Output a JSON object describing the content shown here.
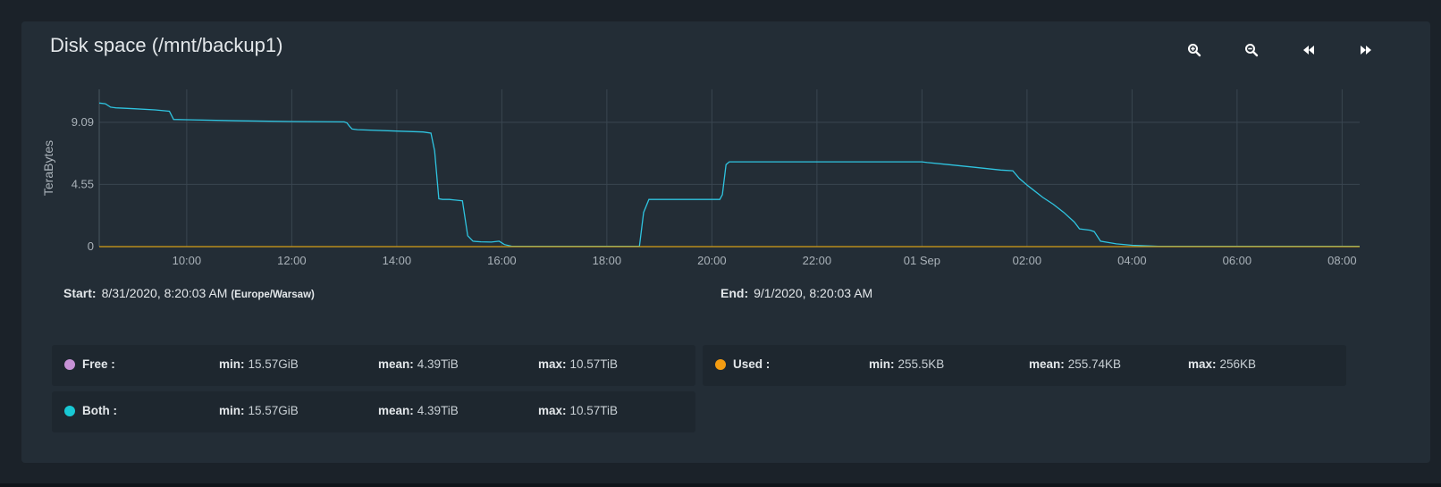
{
  "panel": {
    "title": "Disk space (/mnt/backup1)"
  },
  "toolbar": {
    "zoom_in_icon": "zoom-in-icon",
    "zoom_out_icon": "zoom-out-icon",
    "back_icon": "rewind-icon",
    "forward_icon": "fast-forward-icon"
  },
  "range": {
    "start_label": "Start:",
    "start_value": "8/31/2020, 8:20:03 AM",
    "start_tz": "(Europe/Warsaw)",
    "end_label": "End:",
    "end_value": "9/1/2020, 8:20:03 AM"
  },
  "legend": [
    {
      "name": "Free :",
      "color": "#c792d6",
      "min_label": "min:",
      "min": "15.57GiB",
      "mean_label": "mean:",
      "mean": "4.39TiB",
      "max_label": "max:",
      "max": "10.57TiB"
    },
    {
      "name": "Used :",
      "color": "#f39c12",
      "min_label": "min:",
      "min": "255.5KB",
      "mean_label": "mean:",
      "mean": "255.74KB",
      "max_label": "max:",
      "max": "256KB"
    },
    {
      "name": "Both :",
      "color": "#18c8d4",
      "min_label": "min:",
      "min": "15.57GiB",
      "mean_label": "mean:",
      "mean": "4.39TiB",
      "max_label": "max:",
      "max": "10.57TiB"
    }
  ],
  "chart_data": {
    "type": "line",
    "ylabel": "TeraBytes",
    "xlabel": "",
    "ylim": [
      0,
      11.5
    ],
    "yticks": [
      0,
      4.55,
      9.09
    ],
    "ytick_labels": [
      "0",
      "4.55",
      "9.09"
    ],
    "xlim": [
      8.334,
      32.334
    ],
    "xticks": [
      10,
      12,
      14,
      16,
      18,
      20,
      22,
      24,
      26,
      28,
      30,
      32
    ],
    "xtick_labels": [
      "10:00",
      "12:00",
      "14:00",
      "16:00",
      "18:00",
      "20:00",
      "22:00",
      "01 Sep",
      "02:00",
      "04:00",
      "06:00",
      "08:00"
    ],
    "grid": true,
    "series": [
      {
        "color": "#2fc4e0",
        "x": [
          8.334,
          8.45,
          8.55,
          8.65,
          9.0,
          9.4,
          9.67,
          9.75,
          10.0,
          11.0,
          12.0,
          13.0,
          13.05,
          13.1,
          13.15,
          13.25,
          14.0,
          14.5,
          14.65,
          14.72,
          14.8,
          14.87,
          15.0,
          15.25,
          15.35,
          15.45,
          15.5,
          15.6,
          15.8,
          15.95,
          16.05,
          16.2,
          16.4,
          17.0,
          18.0,
          18.0,
          18.62,
          18.7,
          18.8,
          19.0,
          19.5,
          20.0,
          20.15,
          20.2,
          20.27,
          20.33,
          20.5,
          21.0,
          22.0,
          23.0,
          24.0,
          24.1,
          24.5,
          25.0,
          25.5,
          25.73,
          25.85,
          26.0,
          26.1,
          26.3,
          26.5,
          26.7,
          26.9,
          27.0,
          27.2,
          27.28,
          27.4,
          27.7,
          28.0,
          28.5,
          30.0,
          32.0,
          32.334
        ],
        "y": [
          10.5,
          10.45,
          10.2,
          10.15,
          10.08,
          10.0,
          9.9,
          9.3,
          9.28,
          9.2,
          9.15,
          9.12,
          9.05,
          8.8,
          8.6,
          8.55,
          8.45,
          8.38,
          8.3,
          7.0,
          3.5,
          3.45,
          3.45,
          3.35,
          0.8,
          0.4,
          0.38,
          0.35,
          0.33,
          0.4,
          0.15,
          0.02,
          0.02,
          0.02,
          0.02,
          0.02,
          0.02,
          2.5,
          3.45,
          3.45,
          3.45,
          3.45,
          3.45,
          3.8,
          6.0,
          6.2,
          6.2,
          6.2,
          6.2,
          6.2,
          6.2,
          6.15,
          6.0,
          5.8,
          5.6,
          5.55,
          5.0,
          4.5,
          4.2,
          3.6,
          3.1,
          2.5,
          1.8,
          1.3,
          1.2,
          1.1,
          0.4,
          0.2,
          0.1,
          0.02,
          0.02,
          0.02,
          0.02
        ]
      },
      {
        "color": "#d4a017",
        "x": [
          8.334,
          32.334
        ],
        "y": [
          0.0,
          0.0
        ]
      }
    ]
  }
}
